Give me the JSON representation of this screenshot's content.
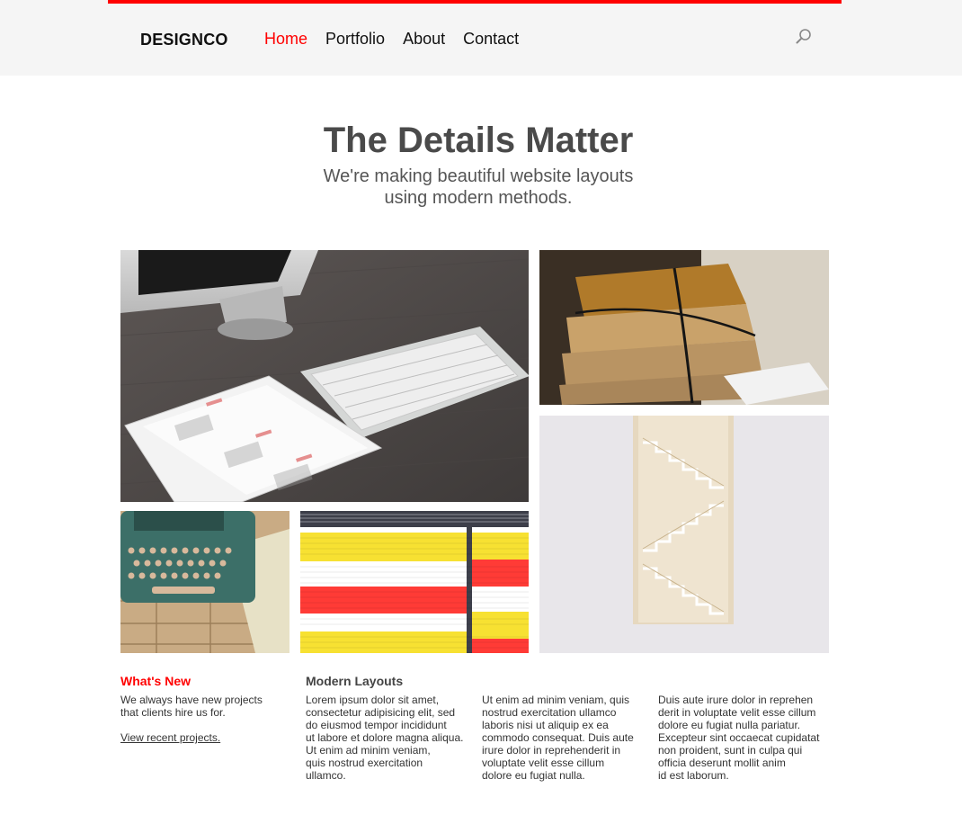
{
  "header": {
    "brand": "DESIGNCO",
    "nav": [
      "Home",
      "Portfolio",
      "About",
      "Contact"
    ],
    "active_nav": "Home",
    "accent_color": "#ff0000",
    "search_icon": "search-icon"
  },
  "hero": {
    "title": "The Details Matter",
    "subtitle_lines": [
      "We're making beautiful website layouts",
      "using modern methods."
    ]
  },
  "gallery": [
    {
      "name": "desk-computer-ipad-image",
      "alt": "iMac, keyboard and iPad calendar on a wooden desk"
    },
    {
      "name": "parcels-image",
      "alt": "Stack of tied paper parcels"
    },
    {
      "name": "staircase-image",
      "alt": "White staircase"
    },
    {
      "name": "typewriter-image",
      "alt": "Teal typewriter on wooden floor"
    },
    {
      "name": "colored-stripes-image",
      "alt": "Yellow, red and white stripes"
    }
  ],
  "columns": {
    "whats_new": {
      "heading": "What's New",
      "text_lines": [
        "We always have new projects",
        "that clients hire us for."
      ],
      "link": "View recent projects."
    },
    "modern_layouts": {
      "heading": "Modern Layouts",
      "col1_lines": [
        "Lorem ipsum dolor sit amet,",
        "consectetur adipisicing elit, sed",
        "do eiusmod tempor incididunt",
        "ut labore et dolore magna aliqua.",
        "Ut enim ad minim veniam,",
        "quis nostrud exercitation",
        "ullamco."
      ],
      "col2_lines": [
        "Ut enim ad minim veniam, quis",
        "nostrud exercitation ullamco",
        "laboris nisi ut aliquip ex ea",
        "commodo consequat. Duis aute",
        "irure dolor in reprehenderit in",
        "voluptate velit esse cillum",
        "dolore eu fugiat nulla."
      ],
      "col3_lines": [
        "Duis aute irure dolor in reprehen",
        "derit in voluptate velit esse cillum",
        "dolore eu fugiat nulla pariatur.",
        "Excepteur sint occaecat cupidatat",
        "non proident, sunt in culpa qui",
        "officia deserunt mollit anim",
        "id est laborum."
      ]
    }
  }
}
